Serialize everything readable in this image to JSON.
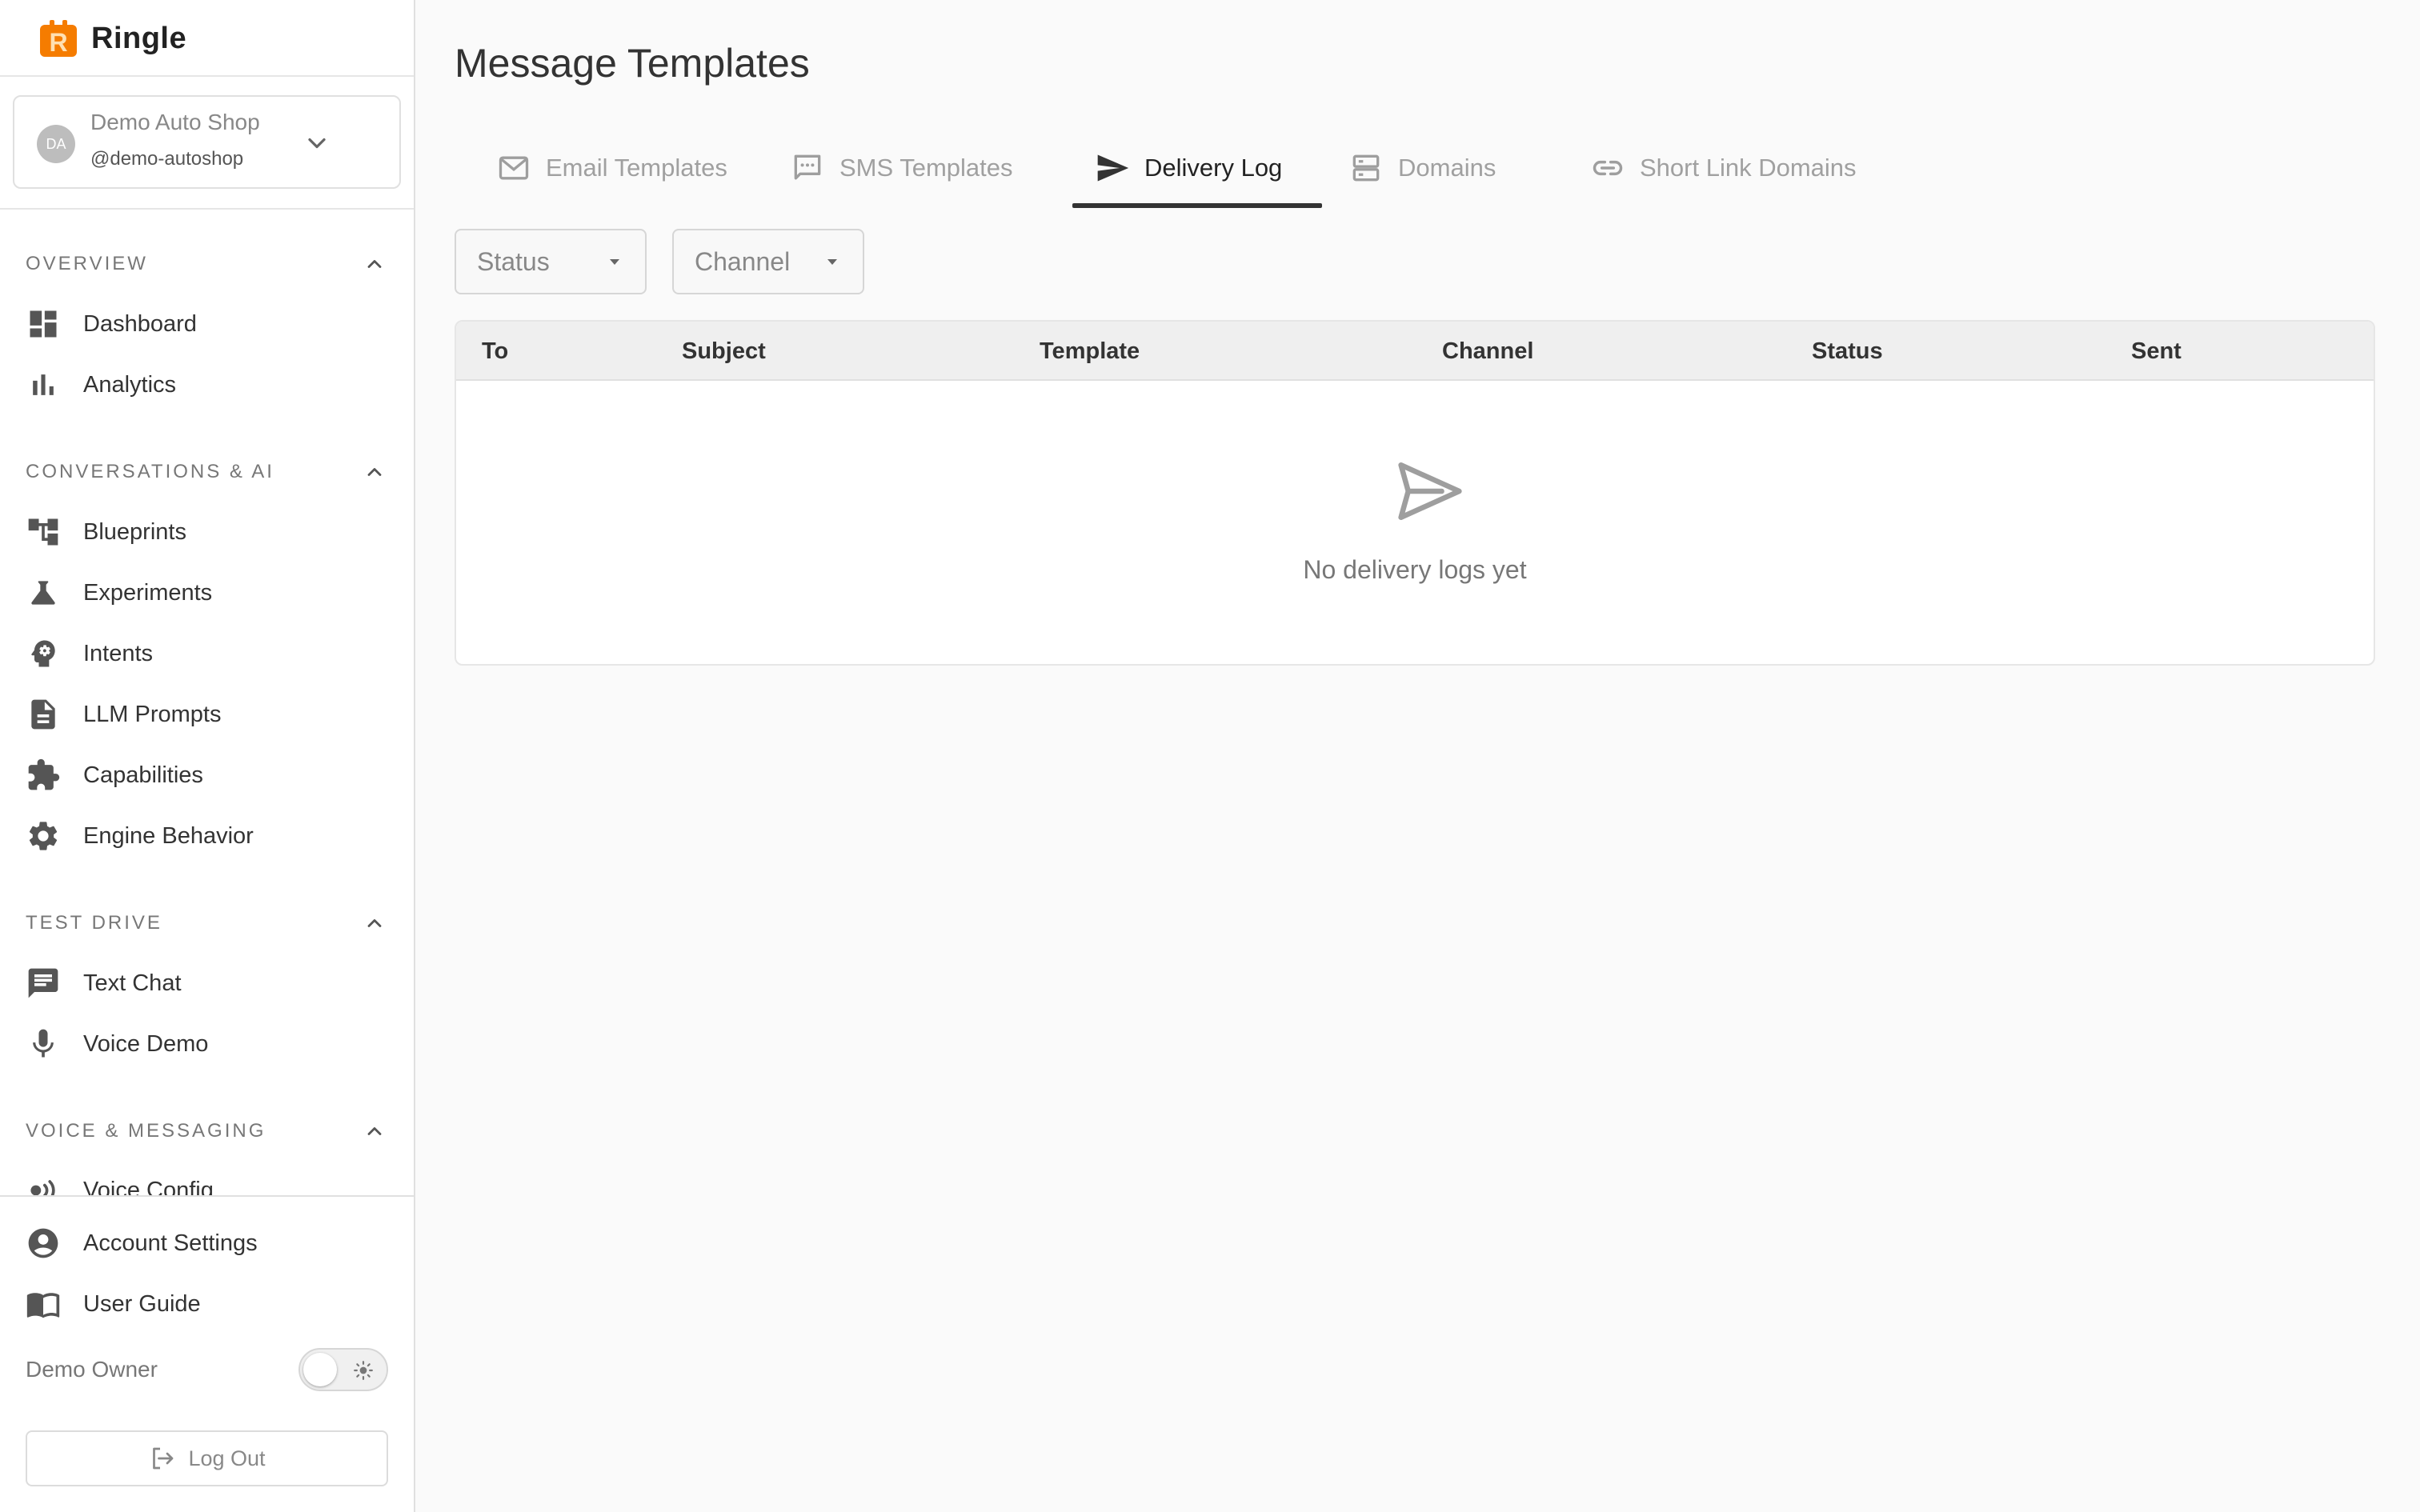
{
  "brand": {
    "name": "Ringle",
    "logo_letter": "R",
    "accent": "#f57c00"
  },
  "org": {
    "avatar_initials": "DA",
    "name": "Demo Auto Shop",
    "handle": "@demo-autoshop"
  },
  "sections": [
    {
      "title": "OVERVIEW",
      "items": [
        {
          "label": "Dashboard",
          "icon": "dashboard-icon"
        },
        {
          "label": "Analytics",
          "icon": "bar-chart-icon"
        }
      ]
    },
    {
      "title": "CONVERSATIONS & AI",
      "items": [
        {
          "label": "Blueprints",
          "icon": "flow-tree-icon"
        },
        {
          "label": "Experiments",
          "icon": "flask-icon"
        },
        {
          "label": "Intents",
          "icon": "head-gear-icon"
        },
        {
          "label": "LLM Prompts",
          "icon": "document-icon"
        },
        {
          "label": "Capabilities",
          "icon": "puzzle-icon"
        },
        {
          "label": "Engine Behavior",
          "icon": "gear-icon"
        }
      ]
    },
    {
      "title": "TEST DRIVE",
      "items": [
        {
          "label": "Text Chat",
          "icon": "chat-icon"
        },
        {
          "label": "Voice Demo",
          "icon": "microphone-icon"
        }
      ]
    },
    {
      "title": "VOICE & MESSAGING",
      "items": [
        {
          "label": "Voice Config",
          "icon": "voice-wave-icon"
        }
      ]
    }
  ],
  "bottom": {
    "account_settings": "Account Settings",
    "user_guide": "User Guide",
    "owner_name": "Demo Owner",
    "theme_toggle_on": false,
    "logout": "Log Out"
  },
  "main": {
    "title": "Message Templates",
    "tabs": [
      {
        "label": "Email Templates",
        "icon": "mail-icon",
        "active": false
      },
      {
        "label": "SMS Templates",
        "icon": "sms-icon",
        "active": false
      },
      {
        "label": "Delivery Log",
        "icon": "send-icon",
        "active": true
      },
      {
        "label": "Domains",
        "icon": "server-icon",
        "active": false
      },
      {
        "label": "Short Link Domains",
        "icon": "link-icon",
        "active": false
      }
    ],
    "filters": [
      {
        "label": "Status"
      },
      {
        "label": "Channel"
      }
    ],
    "table": {
      "columns": [
        "To",
        "Subject",
        "Template",
        "Channel",
        "Status",
        "Sent"
      ],
      "rows": [],
      "empty_message": "No delivery logs yet"
    }
  }
}
